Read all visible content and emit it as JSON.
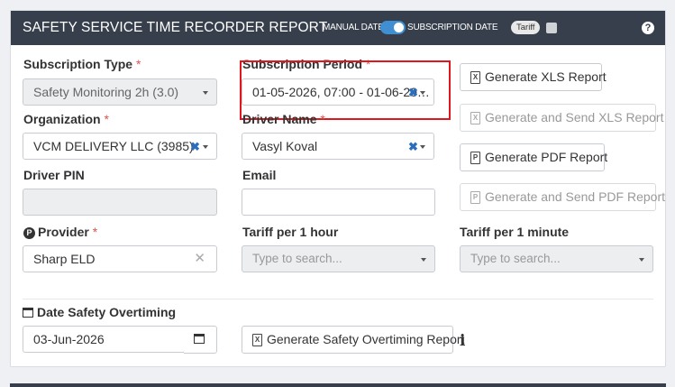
{
  "header": {
    "title": "SAFETY SERVICE TIME RECORDER REPORT",
    "manual_date": "MANUAL DATE",
    "subscription_date": "SUBSCRIPTION DATE",
    "tariff_pill": "Tariff",
    "help_icon": "question-circle-icon",
    "accent": "#3f8fd2",
    "bar_color": "#363f4b"
  },
  "form": {
    "subscription_type": {
      "label": "Subscription Type",
      "required": "*",
      "value": "Safety Monitoring 2h (3.0)"
    },
    "subscription_period": {
      "label": "Subscription Period",
      "required": "*",
      "value": "01-05-2026, 07:00 - 01-06-20…"
    },
    "organization": {
      "label": "Organization",
      "required": "*",
      "value": "VCM DELIVERY LLC (3985)"
    },
    "driver_name": {
      "label": "Driver Name",
      "required": "*",
      "value": "Vasyl Koval"
    },
    "driver_pin": {
      "label": "Driver PIN",
      "value": ""
    },
    "email": {
      "label": "Email",
      "value": ""
    },
    "provider": {
      "label": "Provider",
      "required": "*",
      "badge": "P",
      "value": "Sharp ELD"
    },
    "tariff_hour": {
      "label": "Tariff per 1 hour",
      "placeholder": "Type to search..."
    },
    "tariff_minute": {
      "label": "Tariff per 1 minute",
      "placeholder": "Type to search..."
    },
    "date_overtiming": {
      "label": "Date Safety Overtiming",
      "value": "03-Jun-2026"
    }
  },
  "buttons": {
    "gen_xls": "Generate XLS Report",
    "gen_send_xls": "Generate and Send XLS Report",
    "gen_pdf": "Generate PDF Report",
    "gen_send_pdf": "Generate and Send PDF Report",
    "gen_overtiming": "Generate Safety Overtiming Report"
  },
  "icons": {
    "clear": "✖",
    "clear_grey": "✕",
    "info": "i",
    "xls_glyph": "X",
    "pdf_glyph": "P"
  },
  "highlight_color": "#e0171d"
}
